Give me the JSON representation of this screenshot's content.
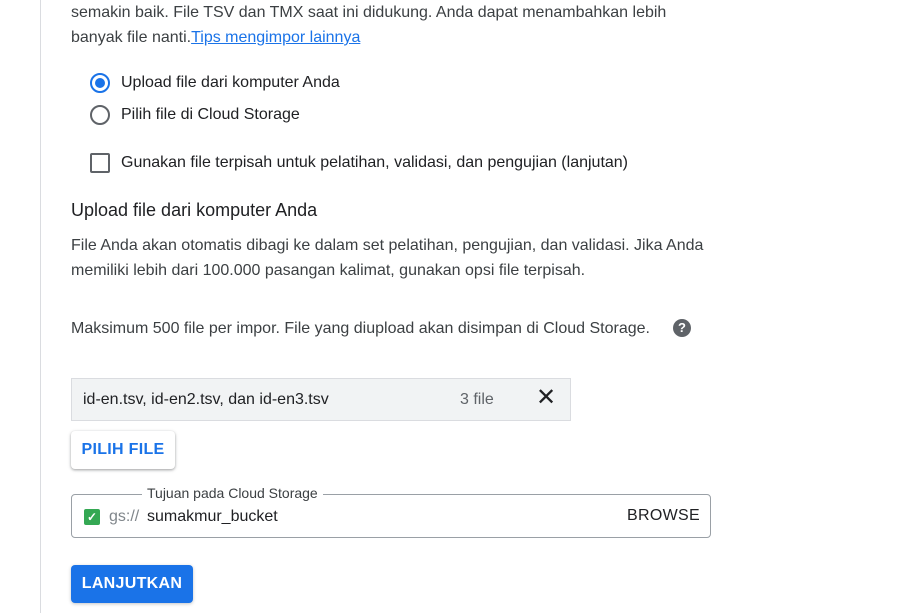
{
  "intro": {
    "line1": "semakin baik. File TSV dan TMX saat ini didukung. Anda dapat menambahkan lebih",
    "line2": "banyak file nanti.",
    "link": "Tips mengimpor lainnya"
  },
  "source_options": [
    {
      "label": "Upload file dari komputer Anda",
      "selected": true
    },
    {
      "label": "Pilih file di Cloud Storage",
      "selected": false
    }
  ],
  "separate_files": {
    "label": "Gunakan file terpisah untuk pelatihan, validasi, dan pengujian (lanjutan)",
    "checked": false
  },
  "upload_section": {
    "title": "Upload file dari komputer Anda",
    "description": "File Anda akan otomatis dibagi ke dalam set pelatihan, pengujian, dan validasi. Jika Anda memiliki lebih dari 100.000 pasangan kalimat, gunakan opsi file terpisah.",
    "max_note": "Maksimum 500 file per impor. File yang diupload akan disimpan di Cloud Storage.",
    "help_glyph": "?"
  },
  "selected_files": {
    "names": "id-en.tsv, id-en2.tsv, dan id-en3.tsv",
    "count": "3 file",
    "clear_glyph": "✕"
  },
  "choose_button": "PILIH FILE",
  "destination": {
    "legend": "Tujuan pada Cloud Storage",
    "prefix": "gs://",
    "value": "sumakmur_bucket",
    "browse": "BROWSE",
    "check_glyph": "✓"
  },
  "continue_button": "LANJUTKAN",
  "colors": {
    "accent": "#1a73e8",
    "success": "#34a853"
  },
  "icons": {
    "help": "help-circle-icon",
    "clear": "close-icon",
    "valid": "check-box-icon"
  }
}
